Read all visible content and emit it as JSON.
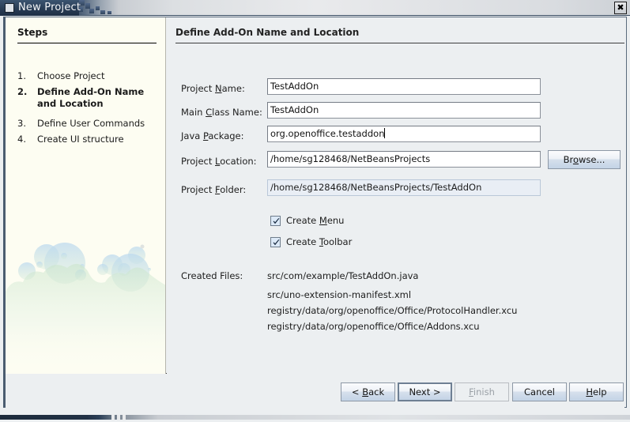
{
  "window": {
    "title": "New Project",
    "icon": "window-icon",
    "close_label": "✖"
  },
  "steps": {
    "heading": "Steps",
    "items": [
      {
        "num": "1.",
        "label": "Choose Project",
        "active": false
      },
      {
        "num": "2.",
        "label": "Define Add-On Name and Location",
        "active": true
      },
      {
        "num": "3.",
        "label": "Define User Commands",
        "active": false
      },
      {
        "num": "4.",
        "label": "Create UI structure",
        "active": false
      }
    ]
  },
  "main": {
    "title": "Define Add-On Name and Location",
    "fields": [
      {
        "label_pre": "Project ",
        "label_mn": "N",
        "label_post": "ame:",
        "value": "TestAddOn",
        "readonly": false,
        "caret": false
      },
      {
        "label_pre": "Main ",
        "label_mn": "C",
        "label_post": "lass Name:",
        "value": "TestAddOn",
        "readonly": false,
        "caret": false
      },
      {
        "label_pre": "Java ",
        "label_mn": "P",
        "label_post": "ackage:",
        "value": "org.openoffice.testaddon",
        "readonly": false,
        "caret": true
      },
      {
        "label_pre": "Project ",
        "label_mn": "L",
        "label_post": "ocation:",
        "value": "/home/sg128468/NetBeansProjects",
        "readonly": false,
        "caret": false
      },
      {
        "label_pre": "Project ",
        "label_mn": "F",
        "label_post": "older:",
        "value": "/home/sg128468/NetBeansProjects/TestAddOn",
        "readonly": true,
        "caret": false
      }
    ],
    "browse_button": {
      "pre": "Br",
      "mn": "o",
      "post": "wse..."
    },
    "checkboxes": [
      {
        "pre": "Create ",
        "mn": "M",
        "post": "enu",
        "checked": true
      },
      {
        "pre": "Create ",
        "mn": "T",
        "post": "oolbar",
        "checked": true
      }
    ],
    "created_files_label": "Created Files:",
    "created_files": [
      "src/com/example/TestAddOn.java",
      "src/uno-extension-manifest.xml",
      "registry/data/org/openoffice/Office/ProtocolHandler.xcu",
      "registry/data/org/openoffice/Office/Addons.xcu"
    ]
  },
  "buttons": [
    {
      "pre": "< ",
      "mn": "B",
      "post": "ack",
      "state": "normal"
    },
    {
      "pre": "Next >",
      "mn": "",
      "post": "",
      "state": "default"
    },
    {
      "pre": "",
      "mn": "F",
      "post": "inish",
      "state": "disabled"
    },
    {
      "pre": "Cancel",
      "mn": "",
      "post": "",
      "state": "normal"
    },
    {
      "pre": "",
      "mn": "H",
      "post": "elp",
      "state": "normal"
    }
  ],
  "colors": {
    "titlebar_dark": "#27394f",
    "panel_bg": "#eceff1",
    "steps_bg": "#fdfdf2",
    "field_bg": "#ffffff",
    "readonly_bg": "#e9eef5",
    "checkbox_bg": "#dce9f7"
  }
}
